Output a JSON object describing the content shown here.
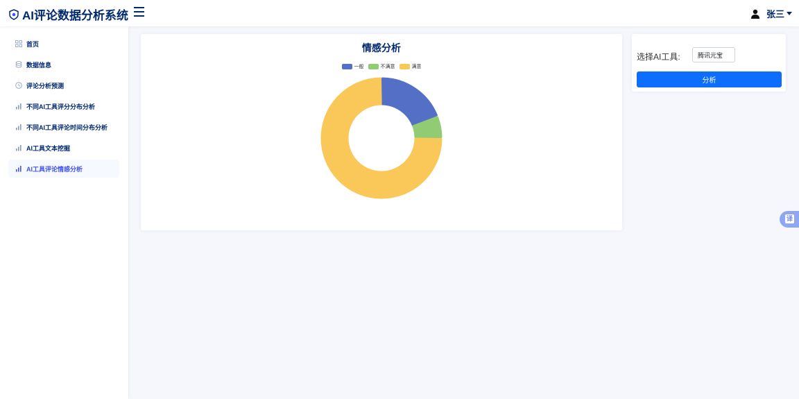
{
  "header": {
    "title": "AI评论数据分析系统",
    "logo_icon": "shield-logo-icon",
    "menu_icon": "hamburger-menu-icon",
    "user_name": "张三",
    "user_icon": "person-icon"
  },
  "sidebar": {
    "items": [
      {
        "label": "首页",
        "icon": "grid-icon",
        "active": false
      },
      {
        "label": "数据信息",
        "icon": "database-icon",
        "active": false
      },
      {
        "label": "评论分析预测",
        "icon": "clock-icon",
        "active": false
      },
      {
        "label": "不同AI工具评分分布分析",
        "icon": "bar-chart-icon",
        "active": false
      },
      {
        "label": "不同AI工具评论时间分布分析",
        "icon": "bar-chart-icon",
        "active": false
      },
      {
        "label": "AI工具文本挖掘",
        "icon": "bar-chart-icon",
        "active": false
      },
      {
        "label": "AI工具评论情感分析",
        "icon": "bar-chart-icon",
        "active": true
      }
    ]
  },
  "tool_panel": {
    "label": "选择AI工具:",
    "selected_tool": "腾讯元宝",
    "analyze_label": "分析"
  },
  "translate_label": "译",
  "chart_data": {
    "type": "pie",
    "title": "情感分析",
    "legend_position": "top-center",
    "inner_radius_ratio": 0.57,
    "series": [
      {
        "name": "一般",
        "value": 19,
        "color": "#5470c6"
      },
      {
        "name": "不满意",
        "value": 6,
        "color": "#91cc75"
      },
      {
        "name": "满意",
        "value": 75,
        "color": "#fac858"
      }
    ]
  }
}
